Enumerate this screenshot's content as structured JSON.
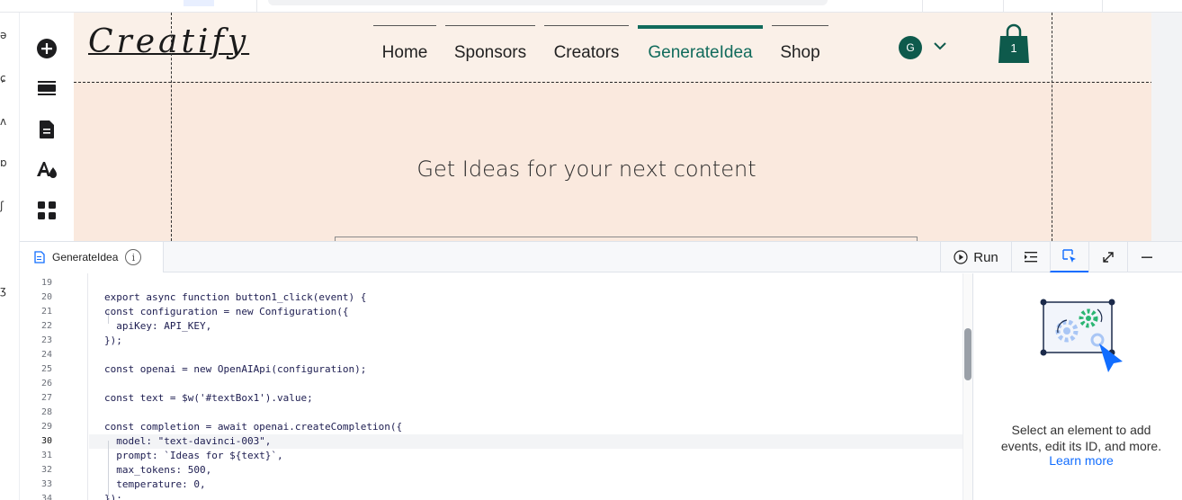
{
  "site": {
    "logo": "Creatify",
    "nav": [
      {
        "label": "Home"
      },
      {
        "label": "Sponsors"
      },
      {
        "label": "Creators"
      },
      {
        "label": "GenerateIdea"
      },
      {
        "label": "Shop"
      }
    ],
    "active_nav": "GenerateIdea",
    "user_initial": "G",
    "cart_count": "1",
    "headline": "Get Ideas for your next content"
  },
  "left_strip_glyphs": [
    "ə",
    "ɕ",
    "ʌ",
    "ɒ",
    "ʃ",
    "ʒ"
  ],
  "tools": [
    {
      "icon": "add-icon"
    },
    {
      "icon": "sections-icon"
    },
    {
      "icon": "pages-icon"
    },
    {
      "icon": "design-icon"
    },
    {
      "icon": "apps-icon"
    }
  ],
  "panel": {
    "tab_label": "GenerateIdea",
    "run_label": "Run"
  },
  "code": {
    "current_line": 30,
    "lines": [
      {
        "n": 19,
        "text": ""
      },
      {
        "n": 20,
        "text": "export async function button1_click(event) {"
      },
      {
        "n": 21,
        "text": "const configuration = new Configuration({"
      },
      {
        "n": 22,
        "text": "  apiKey: API_KEY,"
      },
      {
        "n": 23,
        "text": "});"
      },
      {
        "n": 24,
        "text": ""
      },
      {
        "n": 25,
        "text": "const openai = new OpenAIApi(configuration);"
      },
      {
        "n": 26,
        "text": ""
      },
      {
        "n": 27,
        "text": "const text = $w('#textBox1').value;"
      },
      {
        "n": 28,
        "text": ""
      },
      {
        "n": 29,
        "text": "const completion = await openai.createCompletion({"
      },
      {
        "n": 30,
        "text": "  model: \"text-davinci-003\","
      },
      {
        "n": 31,
        "text": "  prompt: `Ideas for ${text}`,"
      },
      {
        "n": 32,
        "text": "  max_tokens: 500,"
      },
      {
        "n": 33,
        "text": "  temperature: 0,"
      },
      {
        "n": 34,
        "text": "});"
      }
    ]
  },
  "properties_panel": {
    "message": "Select an element to add events, edit its ID, and more.",
    "link": "Learn more"
  },
  "colors": {
    "brand_green": "#116b5c",
    "canvas_bg": "#fae9de",
    "accent_blue": "#116dff"
  }
}
